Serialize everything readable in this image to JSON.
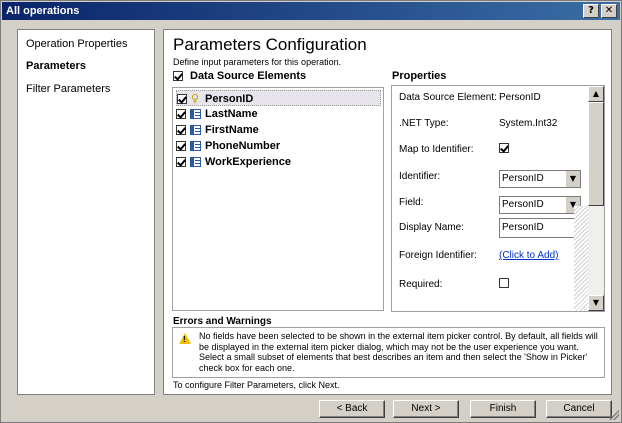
{
  "window": {
    "title": "All operations",
    "help_glyph": "?",
    "close_glyph": "✕"
  },
  "nav": {
    "items": [
      "Operation Properties",
      "Parameters",
      "Filter Parameters"
    ],
    "active": "Parameters"
  },
  "page": {
    "title": "Parameters Configuration",
    "subtitle": "Define input parameters for this operation."
  },
  "data_source": {
    "header": "Data Source Elements",
    "header_checked": true,
    "items": [
      {
        "label": "PersonID",
        "icon": "key-icon",
        "checked": true,
        "selected": true
      },
      {
        "label": "LastName",
        "icon": "field-icon",
        "checked": true
      },
      {
        "label": "FirstName",
        "icon": "field-icon",
        "checked": true
      },
      {
        "label": "PhoneNumber",
        "icon": "field-icon",
        "checked": true
      },
      {
        "label": "WorkExperience",
        "icon": "field-icon",
        "checked": true
      }
    ]
  },
  "properties": {
    "header": "Properties",
    "data_source_element_label": "Data Source Element:",
    "data_source_element_value": "PersonID",
    "net_type_label": ".NET Type:",
    "net_type_value": "System.Int32",
    "map_to_identifier_label": "Map to Identifier:",
    "map_to_identifier_checked": true,
    "identifier_label": "Identifier:",
    "identifier_value": "PersonID",
    "field_label": "Field:",
    "field_value": "PersonID",
    "display_name_label": "Display Name:",
    "display_name_value": "PersonID",
    "foreign_identifier_label": "Foreign Identifier:",
    "foreign_identifier_link": "(Click to Add)",
    "required_label": "Required:",
    "required_checked": false
  },
  "errors": {
    "header": "Errors and Warnings",
    "message": "No fields have been selected to be shown in the external item picker control. By default, all fields will be displayed in the external item picker dialog, which may not be the user experience you want. Select a small subset of elements that best describes an item and then select the 'Show in Picker' check box for each one."
  },
  "footer_note": "To configure Filter Parameters, click Next.",
  "buttons": {
    "back": "< Back",
    "next": "Next >",
    "finish": "Finish",
    "cancel": "Cancel"
  },
  "colors": {
    "title_bar": "#0a246a",
    "dialog_face": "#d4d0c8",
    "link": "#0033cc",
    "warning": "#f0c000"
  }
}
